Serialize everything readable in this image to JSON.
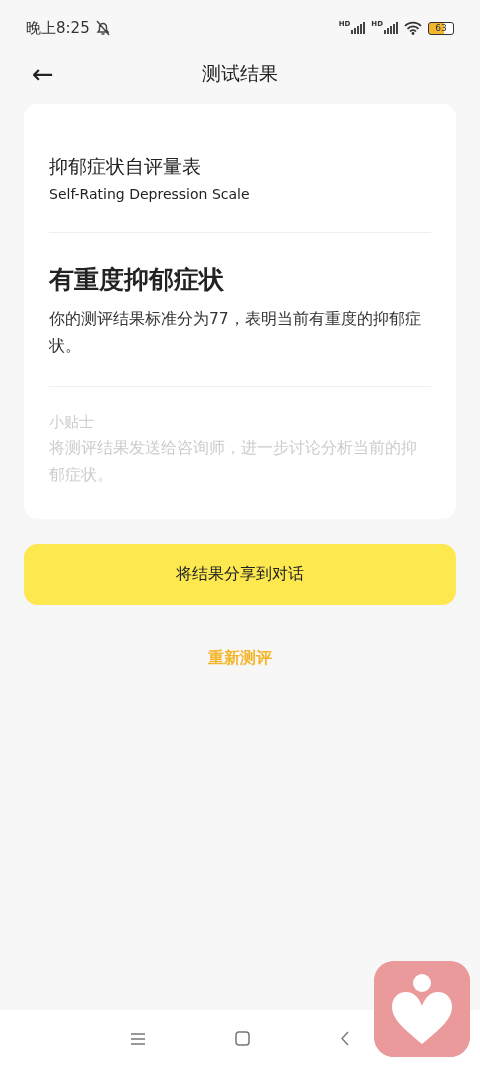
{
  "status_bar": {
    "time": "晚上8:25",
    "network_labels": [
      "HD",
      "HD"
    ],
    "battery": "63"
  },
  "header": {
    "back": "←",
    "title": "测试结果"
  },
  "card": {
    "scale_title": "抑郁症状自评量表",
    "scale_subtitle": "Self-Rating Depression Scale",
    "result_title": "有重度抑郁症状",
    "result_text": "你的测评结果标准分为77，表明当前有重度的抑郁症状。",
    "tip_title": "小贴士",
    "tip_text": "将测评结果发送给咨询师，进一步讨论分析当前的抑郁症状。"
  },
  "share_button": "将结果分享到对话",
  "retest_link": "重新测评"
}
